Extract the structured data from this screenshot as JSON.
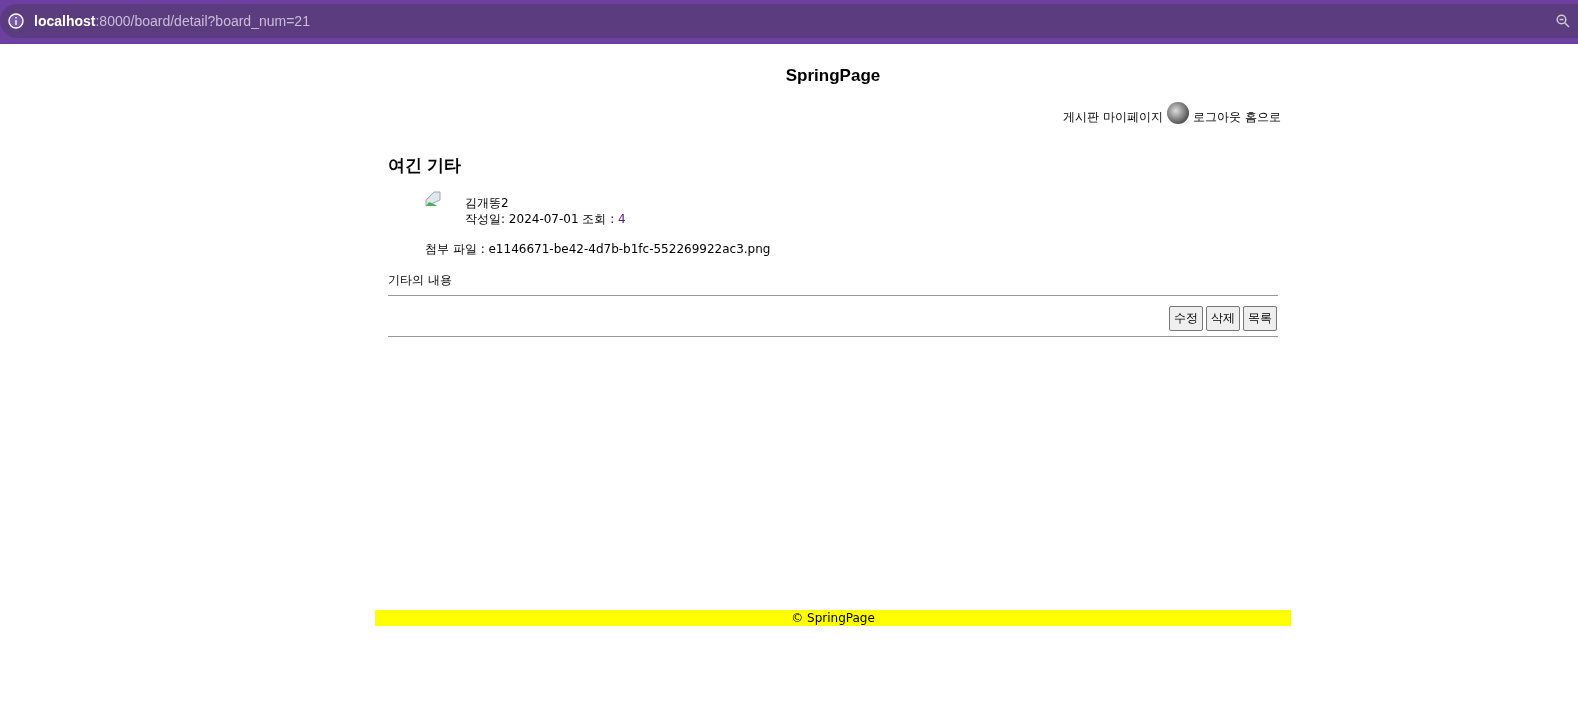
{
  "browser": {
    "url_host": "localhost",
    "url_rest": ":8000/board/detail?board_num=21"
  },
  "site_title": "SpringPage",
  "nav": [
    {
      "label": "게시판",
      "kind": "link"
    },
    {
      "label": "마이페이지",
      "kind": "link"
    },
    {
      "kind": "avatar"
    },
    {
      "label": "로그아웃",
      "kind": "link"
    },
    {
      "label": "홈으로",
      "kind": "link"
    }
  ],
  "post": {
    "title": "여긴 기타",
    "author": "김개똥2",
    "date_label": "작성일: 2024-07-01 조회 : ",
    "views": "4",
    "attachment": "첨부 파일 : e1146671-be42-4d7b-b1fc-552269922ac3.png",
    "content": "기타의 내용"
  },
  "buttons": [
    "수정",
    "삭제",
    "목록"
  ],
  "footer": "© SpringPage"
}
